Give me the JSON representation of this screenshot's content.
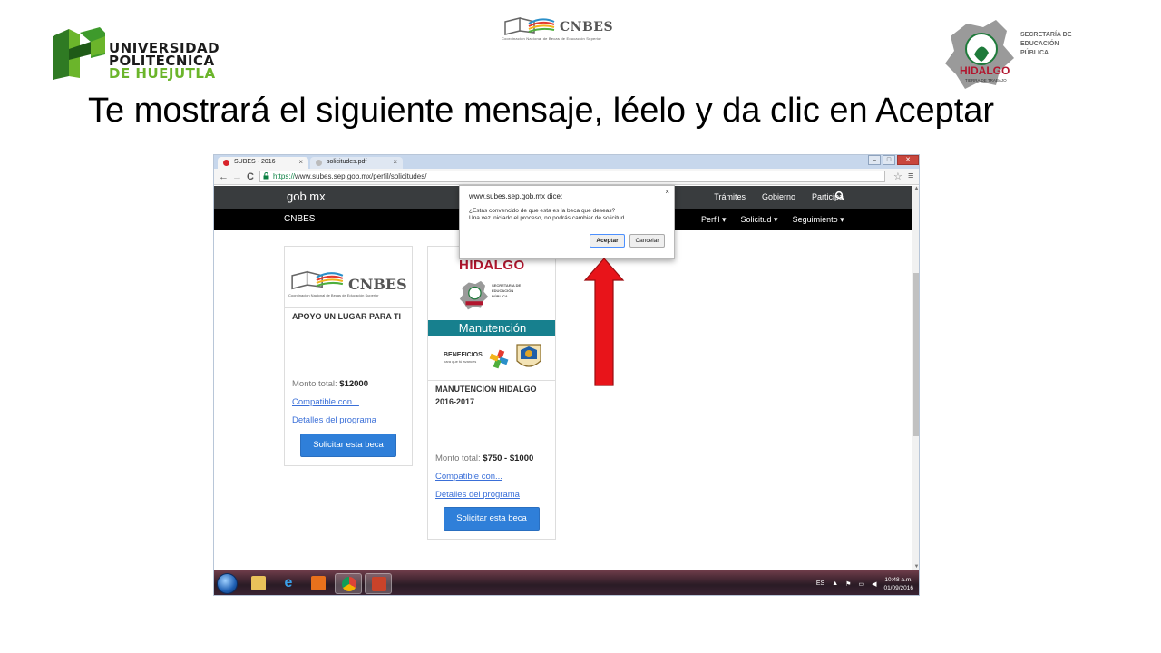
{
  "logos": {
    "upn": {
      "line1": "UNIVERSIDAD",
      "line2": "POLITÉCNICA",
      "line3": "DE HUEJUTLA"
    },
    "cnbes": {
      "name": "CNBES",
      "subtitle": "Coordinación Nacional de Becas de Educación Superior"
    },
    "sep": {
      "line1": "SECRETARÍA DE",
      "line2": "EDUCACIÓN",
      "line3": "PÚBLICA",
      "state": "HIDALGO",
      "slogan": "TIERRA DE TRABAJO"
    }
  },
  "slide_title": "Te mostrará el siguiente mensaje, léelo y da clic en Aceptar",
  "browser": {
    "tabs": [
      {
        "label": "SUBES - 2016",
        "active": true
      },
      {
        "label": "solicitudes.pdf",
        "active": false
      }
    ],
    "window_buttons": {
      "minimize": "–",
      "maximize": "□",
      "close": "✕"
    },
    "url_scheme": "https://",
    "url_rest": "www.subes.sep.gob.mx/perfil/solicitudes/",
    "nav": {
      "back": "←",
      "forward": "→",
      "reload": "C"
    }
  },
  "site": {
    "gob_logo": "gob mx",
    "gob_links": [
      "Trámites",
      "Gobierno",
      "Participa"
    ],
    "cnbes_title": "CNBES",
    "cnbes_links": [
      "Perfil ▾",
      "Solicitud ▾",
      "Seguimiento ▾"
    ]
  },
  "cards": [
    {
      "title": "APOYO UN LUGAR PARA TI",
      "monto_label": "Monto total: ",
      "monto_value": "$12000",
      "link1": "Compatible con...",
      "link2": "Detalles del programa",
      "button": "Solicitar esta beca"
    },
    {
      "title": "MANUTENCION HIDALGO 2016-2017",
      "monto_label": "Monto total: ",
      "monto_value": "$750 - $1000",
      "link1": "Compatible con...",
      "link2": "Detalles del programa",
      "button": "Solicitar esta beca",
      "banner": {
        "state": "HIDALGO",
        "sep": "SECRETARÍA DE EDUCACIÓN PÚBLICA",
        "program": "Manutención",
        "beneficios": "BENEFICIOS",
        "beneficios_sub": "para que tú avances"
      }
    }
  ],
  "dialog": {
    "title": "www.subes.sep.gob.mx dice:",
    "close": "×",
    "message1": "¿Estás convencido de que esta es la beca que deseas?",
    "message2": "Una vez iniciado el proceso, no podrás cambiar de solicitud.",
    "accept": "Aceptar",
    "cancel": "Cancelar"
  },
  "taskbar": {
    "language": "ES",
    "time": "10:48 a.m.",
    "date": "01/09/2016"
  },
  "colors": {
    "arrow": "#e8141a",
    "primary_button": "#2f7fd9",
    "manutencion_band": "#17808e",
    "hidalgo_red": "#b2162e"
  }
}
